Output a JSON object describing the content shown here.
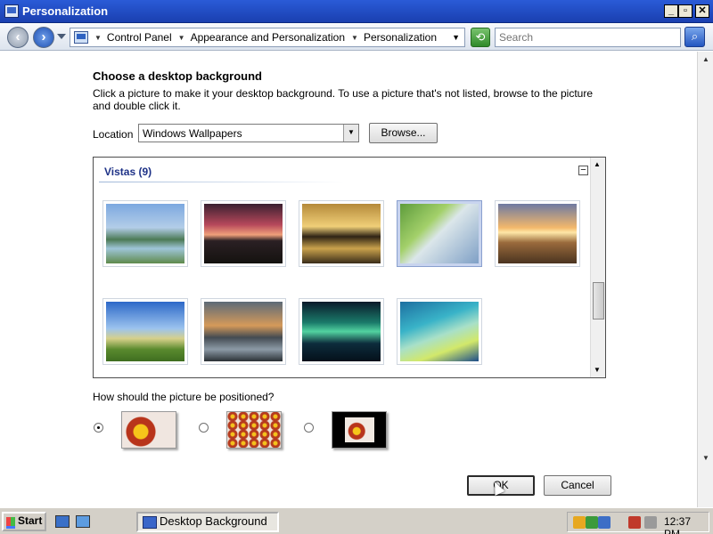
{
  "window": {
    "title": "Personalization",
    "minimize": "_",
    "maximize": "▫",
    "close": "✕"
  },
  "address": {
    "crumbs": [
      "Control Panel",
      "Appearance and Personalization",
      "Personalization"
    ],
    "search_placeholder": "Search"
  },
  "page": {
    "heading": "Choose a desktop background",
    "description": "Click a picture to make it your desktop background. To use a picture that's not listed, browse to the picture and double click it.",
    "location_label": "Location",
    "location_value": "Windows Wallpapers",
    "browse_label": "Browse...",
    "group_title": "Vistas (9)",
    "collapse": "−",
    "wallpapers": [
      {
        "name": "mountain-lake",
        "selected": false
      },
      {
        "name": "sunset-hills",
        "selected": false
      },
      {
        "name": "golden-beach",
        "selected": false
      },
      {
        "name": "palm-leaf",
        "selected": true
      },
      {
        "name": "meadow-sunrise",
        "selected": false
      },
      {
        "name": "green-hills",
        "selected": false
      },
      {
        "name": "canyon-reflection",
        "selected": false
      },
      {
        "name": "aurora",
        "selected": false
      },
      {
        "name": "vista-aurora",
        "selected": false
      }
    ],
    "position_question": "How should the picture be positioned?",
    "position_options": [
      {
        "name": "fit-to-screen",
        "checked": true
      },
      {
        "name": "tile",
        "checked": false
      },
      {
        "name": "center",
        "checked": false
      }
    ],
    "ok_label": "OK",
    "cancel_label": "Cancel"
  },
  "taskbar": {
    "start_label": "Start",
    "task_label": "Desktop Background",
    "clock": "12:37 PM"
  },
  "colors": {
    "titlebar": "#1a3fb0",
    "selection": "#c8d4ee",
    "group_title": "#1e3287"
  }
}
